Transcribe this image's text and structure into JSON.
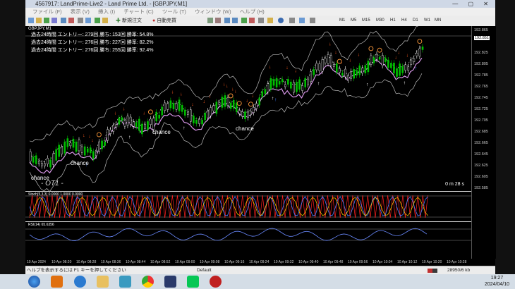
{
  "window": {
    "title": "4567917: LandPrime-Live2 - Land Prime Ltd. - [GBPJPY,M1]",
    "controls": "— ▢ ✕"
  },
  "menu": [
    "ファイル (F)",
    "表示 (V)",
    "挿入 (I)",
    "チャート (C)",
    "ツール (T)",
    "ウィンドウ (W)",
    "ヘルプ (H)"
  ],
  "toolbar": {
    "new_order": "新規注文",
    "auto_trade": "自動売買",
    "timeframes": [
      "M1",
      "M5",
      "M15",
      "M30",
      "H1",
      "H4",
      "D1",
      "W1",
      "MN"
    ]
  },
  "chart": {
    "symbol": "GBPJPY,M1",
    "stats": [
      "過去24時間  エントリー: 279回   勝ち: 153回   勝率: 54.8%",
      "過去24時間  エントリー: 276回   勝ち: 227回   勝率: 82.2%",
      "過去24時間  エントリー: 276回   勝ち: 255回   勝率: 92.4%"
    ],
    "labels": [
      "chance",
      "chance",
      "chance",
      "chance"
    ],
    "watermark": "- OT1 -",
    "countdown": "0 m 28 s",
    "price_badge": "192.851"
  },
  "price_scale": [
    "192.865",
    "192.845",
    "192.825",
    "192.805",
    "192.785",
    "192.765",
    "192.745",
    "192.725",
    "192.705",
    "192.685",
    "192.665",
    "192.645",
    "192.625",
    "192.605",
    "192.585"
  ],
  "osc1": {
    "label": "Stoch(5,3,3) 0.0000 1.0000 0.0000"
  },
  "osc2": {
    "label": "RSI(14) 65.6356"
  },
  "time_scale": [
    "10 Apr 2024",
    "10 Apr 08:20",
    "10 Apr 08:28",
    "10 Apr 08:36",
    "10 Apr 08:44",
    "10 Apr 08:52",
    "10 Apr 09:00",
    "10 Apr 09:08",
    "10 Apr 09:16",
    "10 Apr 09:24",
    "10 Apr 09:32",
    "10 Apr 09:40",
    "10 Apr 09:48",
    "10 Apr 09:56",
    "10 Apr 10:04",
    "10 Apr 10:12",
    "10 Apr 10:20",
    "10 Apr 10:28"
  ],
  "statusbar": {
    "help": "ヘルプを表示するには F1 キーを押してください",
    "profile": "Default",
    "traffic": "28950/6 kb"
  },
  "tray": {
    "time": "19:27",
    "date": "2024/04/10"
  },
  "colors": {
    "bull": "#00c000",
    "bear": "#ffffff",
    "up_arrow": "#3a7bff",
    "down_arrow": "#ff5a1e",
    "band": "#bbbbbb",
    "ma": "#d896e8",
    "circle": "#ff9a3a",
    "stoch_red": "#ff2020",
    "stoch_blue": "#4a7aff",
    "stoch_yellow": "#ffd400"
  }
}
